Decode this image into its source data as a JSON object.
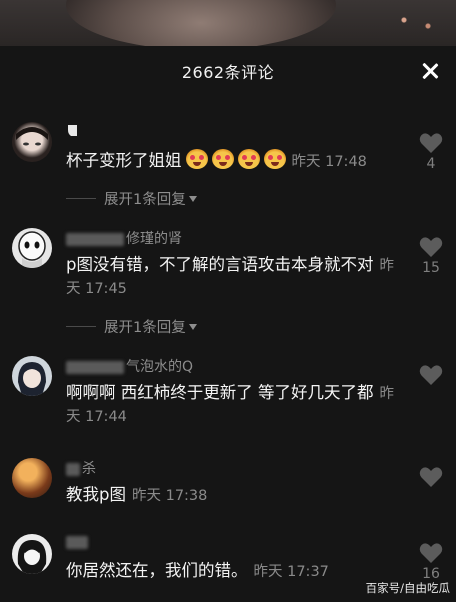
{
  "header": {
    "title": "2662条评论"
  },
  "comments": [
    {
      "username": "",
      "text": "杯子变形了姐姐",
      "emoji_count": 4,
      "time": "昨天 17:48",
      "likes": "4",
      "replies": "展开1条回复"
    },
    {
      "username": "修瑾的肾",
      "text": "p图没有错，不了解的言语攻击本身就不对",
      "time": "昨天 17:45",
      "likes": "15",
      "replies": "展开1条回复"
    },
    {
      "username": "气泡水的Q",
      "text": "啊啊啊 西红柿终于更新了 等了好几天了都",
      "time": "昨天 17:44",
      "likes": ""
    },
    {
      "username": "杀",
      "text": "教我p图",
      "time": "昨天 17:38",
      "likes": ""
    },
    {
      "username": "",
      "text": "你居然还在，我们的错。",
      "time": "昨天 17:37",
      "likes": "16"
    }
  ],
  "watermark": "百家号/自由吃瓜",
  "colors": {
    "background": "#151515",
    "muted": "#8a8a8a",
    "text": "#f4f4f4"
  }
}
